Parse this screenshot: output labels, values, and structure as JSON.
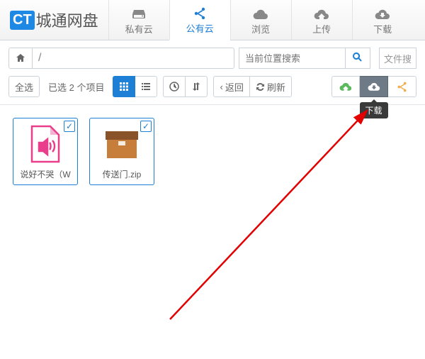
{
  "app": {
    "logo_badge": "CT",
    "logo_text": "城通网盘"
  },
  "tabs": {
    "private": "私有云",
    "public": "公有云",
    "browse": "浏览",
    "upload": "上传",
    "download": "下载"
  },
  "breadcrumb": {
    "path": "/"
  },
  "search": {
    "placeholder": "当前位置搜索"
  },
  "file_filter": "文件搜",
  "toolbar": {
    "select_all": "全选",
    "selected_info": "已选 2 个项目",
    "back": "返回",
    "refresh": "刷新"
  },
  "tooltip": {
    "download": "下载"
  },
  "files": [
    {
      "name": "说好不哭（W"
    },
    {
      "name": "传送门.zip"
    }
  ]
}
